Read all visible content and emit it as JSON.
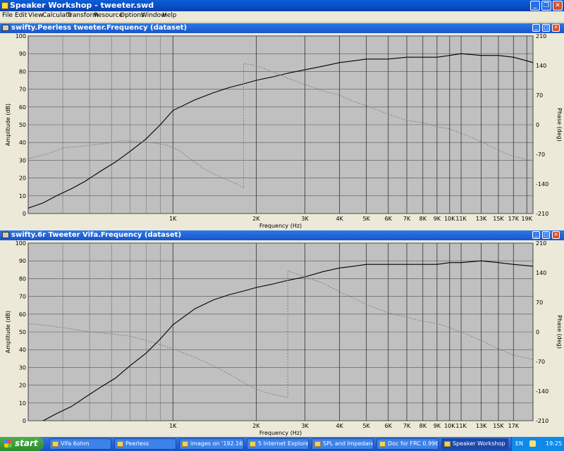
{
  "app": {
    "title": "Speaker Workshop - tweeter.swd",
    "menu": [
      "File",
      "Edit",
      "View",
      "Calculate",
      "Transform",
      "Resource",
      "Options",
      "Window",
      "Help"
    ]
  },
  "windows": [
    {
      "title": "swifty.Peerless tweeter.Frequency (dataset)",
      "y_left_ticks": [
        "100",
        "90",
        "80",
        "70",
        "60",
        "50",
        "40",
        "30",
        "20",
        "10",
        "0"
      ],
      "y_right_ticks": [
        "210",
        "140",
        "70",
        "0",
        "-70",
        "-140",
        "-210"
      ],
      "x_ticks": [
        "1K",
        "2K",
        "3K",
        "4K",
        "5K",
        "6K",
        "7K",
        "8K",
        "9K",
        "10K",
        "11K",
        "13K",
        "15K",
        "17K",
        "19K"
      ],
      "xlabel": "Frequency (Hz)",
      "ylabel_left": "Amplitude (dB)",
      "ylabel_right": "Phase (deg)"
    },
    {
      "title": "swifty.6r Tweeter Vifa.Frequency (dataset)",
      "y_left_ticks": [
        "100",
        "90",
        "80",
        "70",
        "60",
        "50",
        "40",
        "30",
        "20",
        "10",
        "0"
      ],
      "y_right_ticks": [
        "210",
        "140",
        "70",
        "0",
        "-70",
        "-140",
        "-210"
      ],
      "x_ticks": [
        "1K",
        "2K",
        "3K",
        "4K",
        "5K",
        "6K",
        "7K",
        "8K",
        "9K",
        "10K",
        "11K",
        "13K",
        "15K",
        "17K"
      ],
      "xlabel": "Frequency (Hz)",
      "ylabel_left": "Amplitude (dB)",
      "ylabel_right": "Phase (deg)"
    }
  ],
  "chart_data": [
    {
      "type": "line",
      "xscale": "log",
      "xlim": [
        300,
        20000
      ],
      "ylim_left": [
        0,
        100
      ],
      "ylim_right": [
        -210,
        210
      ],
      "grid": true,
      "series": [
        {
          "axis": "left",
          "style": "solid",
          "x": [
            300,
            340,
            380,
            430,
            480,
            550,
            620,
            700,
            800,
            900,
            1000,
            1200,
            1400,
            1600,
            1800,
            2000,
            2300,
            2600,
            3000,
            3500,
            4000,
            4500,
            5000,
            6000,
            7000,
            8000,
            9000,
            10000,
            11000,
            13000,
            15000,
            17000,
            19000,
            20000
          ],
          "y": [
            3,
            6,
            10,
            14,
            18,
            24,
            29,
            35,
            42,
            50,
            58,
            64,
            68,
            71,
            73,
            75,
            77,
            79,
            81,
            83,
            85,
            86,
            87,
            87,
            88,
            88,
            88,
            89,
            90,
            89,
            89,
            88,
            86,
            85
          ]
        },
        {
          "axis": "right",
          "style": "dashed",
          "x": [
            300,
            350,
            400,
            480,
            560,
            650,
            750,
            850,
            950,
            1050,
            1150,
            1300,
            1500,
            1700,
            1800,
            1800,
            2000,
            2300,
            2600,
            3000,
            3500,
            4000,
            4500,
            5000,
            6000,
            7000,
            8000,
            9000,
            10000,
            11000,
            13000,
            15000,
            17000,
            20000
          ],
          "y": [
            -80,
            -70,
            -55,
            -50,
            -45,
            -38,
            -40,
            -43,
            -48,
            -60,
            -80,
            -105,
            -125,
            -140,
            -150,
            145,
            140,
            125,
            110,
            95,
            80,
            70,
            55,
            45,
            25,
            10,
            5,
            -5,
            -10,
            -20,
            -40,
            -60,
            -75,
            -85
          ]
        }
      ]
    },
    {
      "type": "line",
      "xscale": "log",
      "xlim": [
        300,
        20000
      ],
      "ylim_left": [
        0,
        100
      ],
      "ylim_right": [
        -210,
        210
      ],
      "grid": true,
      "series": [
        {
          "axis": "left",
          "style": "solid",
          "x": [
            340,
            380,
            430,
            480,
            550,
            620,
            700,
            800,
            900,
            1000,
            1200,
            1400,
            1600,
            1800,
            2000,
            2300,
            2600,
            3000,
            3500,
            4000,
            4500,
            5000,
            6000,
            7000,
            8000,
            9000,
            10000,
            11000,
            13000,
            15000,
            17000,
            20000
          ],
          "y": [
            0,
            4,
            8,
            13,
            19,
            24,
            31,
            38,
            46,
            54,
            63,
            68,
            71,
            73,
            75,
            77,
            79,
            81,
            84,
            86,
            87,
            88,
            88,
            88,
            88,
            88,
            89,
            89,
            90,
            89,
            88,
            87
          ]
        },
        {
          "axis": "right",
          "style": "dashed",
          "x": [
            300,
            350,
            400,
            450,
            500,
            600,
            700,
            800,
            900,
            1000,
            1200,
            1400,
            1600,
            1800,
            2000,
            2200,
            2600,
            2600,
            3000,
            3500,
            4000,
            4500,
            5000,
            6000,
            7000,
            8000,
            9000,
            10000,
            11000,
            13000,
            15000,
            17000,
            20000
          ],
          "y": [
            20,
            15,
            10,
            5,
            0,
            -5,
            -10,
            -20,
            -30,
            -40,
            -60,
            -80,
            -100,
            -120,
            -135,
            -145,
            -155,
            145,
            130,
            115,
            95,
            80,
            65,
            45,
            35,
            25,
            20,
            10,
            0,
            -20,
            -40,
            -55,
            -65
          ]
        }
      ]
    }
  ],
  "taskbar": {
    "start": "start",
    "tasks": [
      "Vifa 6ohm",
      "Peerless",
      "images on '192.168....",
      "5 Internet Explorer",
      "SPL and Impedance....",
      "Doc for FRC 0.996....",
      "Speaker Workshop ...."
    ],
    "lang": "EN",
    "clock": "19:25"
  }
}
